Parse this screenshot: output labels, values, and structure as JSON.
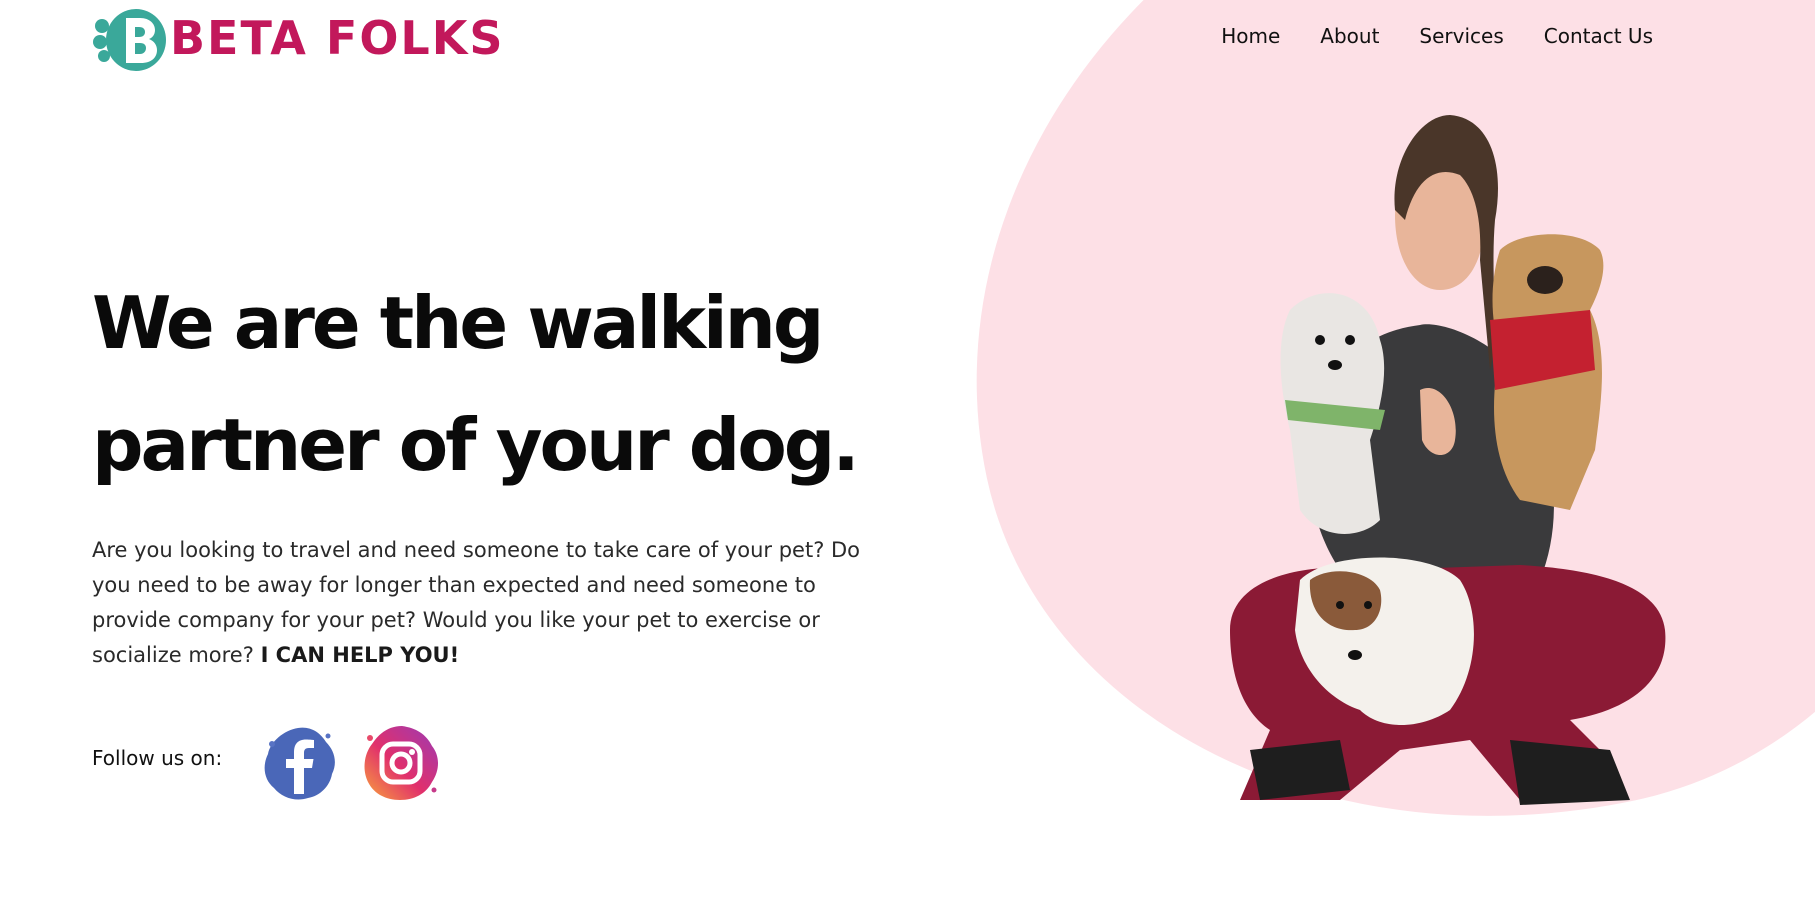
{
  "brand": {
    "logo_text": "BETA FOLKS",
    "colors": {
      "primary": "#c2185b",
      "teal": "#3aa89a",
      "blob": "#fde0e6"
    }
  },
  "nav": {
    "items": [
      {
        "label": "Home"
      },
      {
        "label": "About"
      },
      {
        "label": "Services"
      },
      {
        "label": "Contact Us"
      }
    ]
  },
  "hero": {
    "title_line1": "We are the walking",
    "title_line2": "partner of your dog.",
    "description": "Are you looking to travel and need someone to take care of your pet? Do you need to be away for longer than expected and need someone to provide company for your pet? Would you like your pet to exercise or socialize more?",
    "cta_emphasis": "I CAN HELP YOU!"
  },
  "social": {
    "label": "Follow us on:",
    "icons": [
      "facebook-icon",
      "instagram-icon"
    ]
  }
}
